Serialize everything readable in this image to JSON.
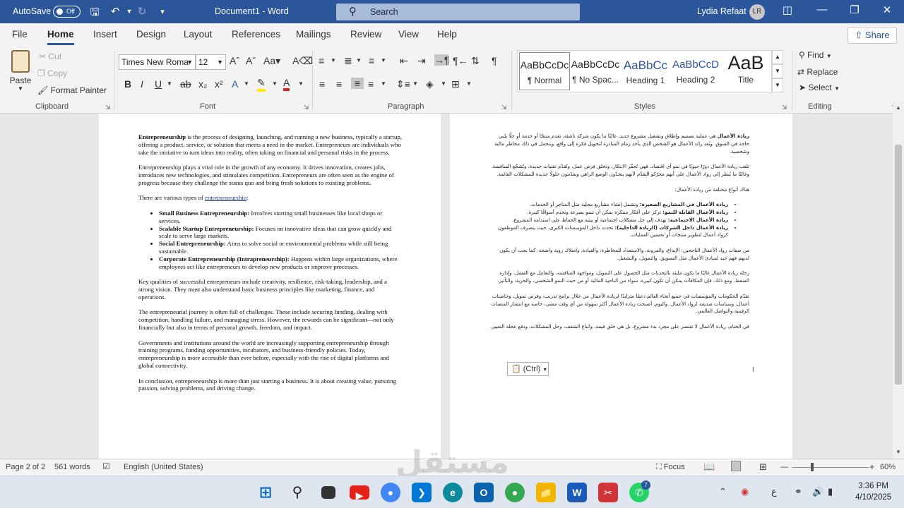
{
  "titlebar": {
    "autosave_label": "AutoSave",
    "autosave_state": "Off",
    "doc_title": "Document1  -  Word",
    "search_placeholder": "Search",
    "user_name": "Lydia Refaat",
    "user_initials": "LR"
  },
  "tabs": [
    "File",
    "Home",
    "Insert",
    "Design",
    "Layout",
    "References",
    "Mailings",
    "Review",
    "View",
    "Help"
  ],
  "active_tab": "Home",
  "share_label": "Share",
  "clipboard": {
    "paste": "Paste",
    "cut": "Cut",
    "copy": "Copy",
    "format_painter": "Format Painter",
    "group": "Clipboard"
  },
  "font": {
    "name": "Times New Roma",
    "size": "12",
    "group": "Font"
  },
  "paragraph_group": "Paragraph",
  "styles": {
    "items": [
      {
        "preview": "AaBbCcDc",
        "name": "¶ Normal"
      },
      {
        "preview": "AaBbCcDc",
        "name": "¶ No Spac..."
      },
      {
        "preview": "AaBbCc",
        "name": "Heading 1"
      },
      {
        "preview": "AaBbCcD",
        "name": "Heading 2"
      },
      {
        "preview": "AaB",
        "name": "Title"
      }
    ],
    "group": "Styles"
  },
  "editing": {
    "find": "Find",
    "replace": "Replace",
    "select": "Select",
    "group": "Editing"
  },
  "left_page": {
    "p1_bold": "Entrepreneurship",
    "p1_rest": " is the process of designing, launching, and running a new business, typically a startup, offering a product, service, or solution that meets a need in the market. Entrepreneurs are individuals who take the initiative to turn ideas into reality, often taking on financial and personal risks in the process.",
    "p2": "Entrepreneurship plays a vital role in the growth of any economy. It drives innovation, creates jobs, introduces new technologies, and stimulates competition. Entrepreneurs are often seen as the engine of progress because they challenge the status quo and bring fresh solutions to existing problems.",
    "p3_pre": "There are various types of ",
    "p3_link": "entrepreneurship",
    "p3_post": ":",
    "bullets": [
      {
        "b": "Small Business Entrepreneurship:",
        "t": " Involves starting small businesses like local shops or services."
      },
      {
        "b": "Scalable Startup Entrepreneurship:",
        "t": " Focuses on innovative ideas that can grow quickly and scale to serve large markets."
      },
      {
        "b": "Social Entrepreneurship:",
        "t": " Aims to solve social or environmental problems while still being sustainable."
      },
      {
        "b": "Corporate Entrepreneurship (Intrapreneurship):",
        "t": " Happens within large organizations, where employees act like entrepreneurs to develop new products or improve processes."
      }
    ],
    "p4": "Key qualities of successful entrepreneurs include creativity, resilience, risk-taking, leadership, and a strong vision. They must also understand basic business principles like marketing, finance, and operations.",
    "p5": "The entrepreneurial journey is often full of challenges. These include securing funding, dealing with competition, handling failure, and managing stress. However, the rewards can be significant—not only financially but also in terms of personal growth, freedom, and impact.",
    "p6": "Governments and institutions around the world are increasingly supporting entrepreneurship through training programs, funding opportunities, incubators, and business-friendly policies. Today, entrepreneurship is more accessible than ever before, especially with the rise of digital platforms and global connectivity.",
    "p7": "In conclusion, entrepreneurship is more than just starting a business. It is about creating value, pursuing passion, solving problems, and driving change."
  },
  "right_page": {
    "p1_bold": "ريادة الأعمال",
    "p1_rest": " هي عملية تصميم وإطلاق وتشغيل مشروع جديد، غالبًا ما يكون شركة ناشئة، تقدم منتجًا أو خدمة أو حلًا يلبي حاجة في السوق. ويُعد رائد الأعمال هو الشخص الذي يأخذ زمام المبادرة لتحويل فكرة إلى واقع، ويتحمل في ذلك مخاطر مالية وشخصية.",
    "p2": "تلعب ريادة الأعمال دورًا حيويًا في نمو أي اقتصاد، فهي تُحفّز الابتكار، وتخلق فرص عمل، وتُقدّم تقنيات جديدة، وتُشجّع المنافسة. وغالبًا ما يُنظر إلى رواد الأعمال على أنهم محرّكو التقدّم لأنهم يتحدّون الوضع الراهن ويقدّمون حلولًا جديدة للمشكلات القائمة.",
    "p3": "هناك أنواع مختلفة من ريادة الأعمال:",
    "bullets": [
      {
        "b": "ريادة الأعمال في المشاريع الصغيرة:",
        "t": " وتشمل إنشاء مشاريع محلية مثل المتاجر أو الخدمات."
      },
      {
        "b": "ريادة الأعمال القابلة للنمو:",
        "t": " تركز على أفكار مبتكرة يمكن أن تنمو بسرعة وتخدم أسواقًا كبيرة."
      },
      {
        "b": "ريادة الأعمال الاجتماعية:",
        "t": " تهدف إلى حل مشكلات اجتماعية أو بيئية مع الحفاظ على استدامة المشروع."
      },
      {
        "b": "ريادة الأعمال داخل الشركات (الريادة الداخلية):",
        "t": " تحدث داخل المؤسسات الكبرى، حيث يتصرف الموظفون كرواد أعمال لتطوير منتجات أو تحسين العمليات."
      }
    ],
    "p4": "من صفات رواد الأعمال الناجحين: الإبداع، والمرونة، والاستعداد للمخاطرة، والقيادة، وامتلاك رؤية واضحة. كما يجب أن يكون لديهم فهم جيد لمبادئ الأعمال مثل التسويق، والتمويل، والتشغيل.",
    "p5": "رحلة ريادة الأعمال غالبًا ما تكون مليئة بالتحديات مثل الحصول على التمويل، ومواجهة المنافسة، والتعامل مع الفشل، وإدارة الضغط. ومع ذلك، فإن المكافآت يمكن أن تكون كبيرة، سواء من الناحية المالية أو من حيث النمو الشخصي، والحرية، والتأثير.",
    "p6": "تقدّم الحكومات والمؤسسات في جميع أنحاء العالم دعمًا متزايدًا لريادة الأعمال من خلال برامج تدريب، وفرص تمويل، وحاضنات أعمال، وسياسات صديقة لرواد الأعمال. واليوم، أصبحت ريادة الأعمال أكثر سهولة من أي وقت مضى، خاصة مع انتشار المنصات الرقمية والتواصل العالمي.",
    "p7": "في الختام، ريادة الأعمال لا تقتصر على مجرد بدء مشروع، بل هي خلق قيمة، واتباع الشغف، وحل المشكلات، ودفع عجلة التغيير.",
    "paste_options": "(Ctrl)"
  },
  "status": {
    "page": "Page 2 of 2",
    "words": "561 words",
    "language": "English (United States)",
    "focus": "Focus",
    "zoom": "60%"
  },
  "clock": {
    "time": "3:36 PM",
    "date": "4/10/2025"
  },
  "tray_lang": "ع",
  "whatsapp_badge": "7",
  "watermark": "مستقل"
}
